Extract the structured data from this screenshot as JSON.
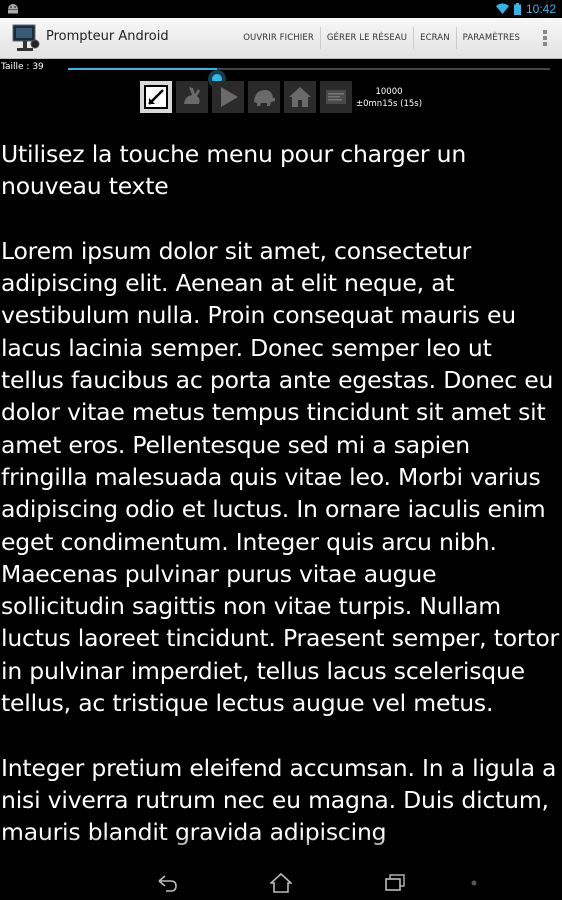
{
  "status_bar": {
    "time": "10:42",
    "icons": [
      "android-icon",
      "wifi-icon",
      "battery-icon"
    ],
    "accent_color": "#33b5e5"
  },
  "action_bar": {
    "app_title": "Prompteur Android",
    "menu": [
      "OUVRIR FICHIER",
      "GÉRER LE RÉSEAU",
      "ECRAN",
      "PARAMÈTRES"
    ],
    "overflow_icon": "overflow-menu-icon"
  },
  "size_slider": {
    "label": "Taille : 39",
    "value_fraction": 0.31
  },
  "toolbar": {
    "buttons": [
      "edit-icon",
      "rabbit-icon",
      "play-icon",
      "turtle-icon",
      "home-icon",
      "display-icon"
    ],
    "selected": "edit-icon",
    "speed_value": "10000",
    "duration": "±0mn15s (15s)"
  },
  "prompt": {
    "intro": "Utilisez la touche menu pour charger un nouveau texte",
    "paragraph1": "Lorem ipsum dolor sit amet, consectetur adipiscing elit. Aenean at elit neque, at vestibulum nulla. Proin consequat mauris eu lacus lacinia semper. Donec semper leo ut tellus faucibus ac porta ante egestas. Donec eu dolor vitae metus tempus tincidunt sit amet sit amet eros. Pellentesque sed mi a sapien fringilla malesuada quis vitae leo. Morbi varius adipiscing odio et luctus. In ornare iaculis enim eget condimentum. Integer quis arcu nibh. Maecenas pulvinar purus vitae augue sollicitudin sagittis non vitae turpis. Nullam luctus laoreet tincidunt. Praesent semper, tortor in pulvinar imperdiet, tellus lacus scelerisque tellus, ac tristique lectus augue vel metus.",
    "paragraph2": "Integer pretium eleifend accumsan. In a ligula a nisi viverra rutrum nec eu magna. Duis dictum, mauris blandit gravida adipiscing"
  },
  "nav_bar": {
    "buttons": [
      "back-icon",
      "home-icon",
      "recent-apps-icon",
      "menu-dot-icon"
    ]
  }
}
